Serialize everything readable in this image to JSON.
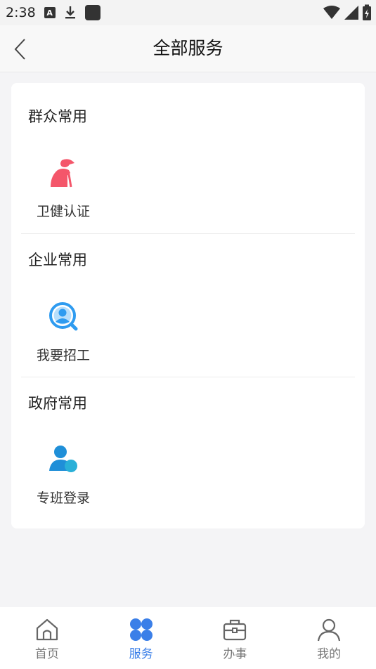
{
  "status_bar": {
    "time": "2:38",
    "icons": [
      "a-notification-icon",
      "download-icon",
      "app-square-icon",
      "wifi-icon",
      "signal-icon",
      "battery-charging-icon"
    ]
  },
  "header": {
    "title": "全部服务",
    "back_icon": "chevron-left-icon"
  },
  "sections": [
    {
      "title": "群众常用",
      "items": [
        {
          "label": "卫健认证",
          "icon": "elderly-person-icon",
          "color": "#f4566a"
        }
      ]
    },
    {
      "title": "企业常用",
      "items": [
        {
          "label": "我要招工",
          "icon": "recruit-search-icon",
          "color": "#2e9bf0"
        }
      ]
    },
    {
      "title": "政府常用",
      "items": [
        {
          "label": "专班登录",
          "icon": "user-login-icon",
          "color": "#1f8fd8"
        }
      ]
    }
  ],
  "bottom_nav": {
    "items": [
      {
        "label": "首页",
        "icon": "home-icon",
        "active": false
      },
      {
        "label": "服务",
        "icon": "services-grid-icon",
        "active": true
      },
      {
        "label": "办事",
        "icon": "briefcase-icon",
        "active": false
      },
      {
        "label": "我的",
        "icon": "profile-icon",
        "active": false
      }
    ],
    "active_color": "#3b7fe8",
    "inactive_color": "#777777"
  }
}
